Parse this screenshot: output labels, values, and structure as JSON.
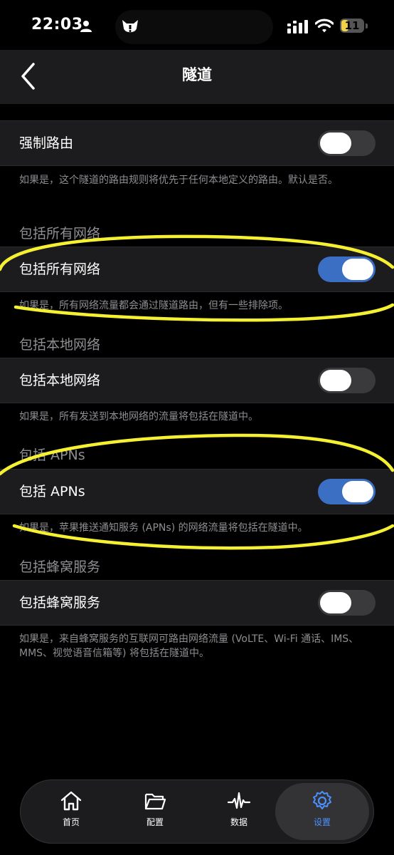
{
  "status_bar": {
    "time": "22:03",
    "battery": "11"
  },
  "nav": {
    "title": "隧道"
  },
  "settings": {
    "force_routing": {
      "label": "强制路由",
      "on": false,
      "description": "如果是，这个隧道的路由规则将优先于任何本地定义的路由。默认是否。"
    },
    "include_all_networks": {
      "header": "包括所有网络",
      "label": "包括所有网络",
      "on": true,
      "description": "如果是，所有网络流量都会通过隧道路由，但有一些排除项。"
    },
    "include_local_networks": {
      "header": "包括本地网络",
      "label": "包括本地网络",
      "on": false,
      "description": "如果是，所有发送到本地网络的流量将包括在隧道中。"
    },
    "include_apns": {
      "header": "包括 APNs",
      "label": "包括 APNs",
      "on": true,
      "description": "如果是，苹果推送通知服务 (APNs) 的网络流量将包括在隧道中。"
    },
    "include_cellular": {
      "header": "包括蜂窝服务",
      "label": "包括蜂窝服务",
      "on": false,
      "description": "如果是，来自蜂窝服务的互联网可路由网络流量 (VoLTE、Wi-Fi 通话、IMS、MMS、视觉语音信箱等) 将包括在隧道中。"
    }
  },
  "tabbar": {
    "home": "首页",
    "config": "配置",
    "data": "数据",
    "settings": "设置"
  },
  "colors": {
    "toggle_on": "#3b6fc4",
    "active_tab": "#4a90ff",
    "annotation": "#f5f032"
  }
}
